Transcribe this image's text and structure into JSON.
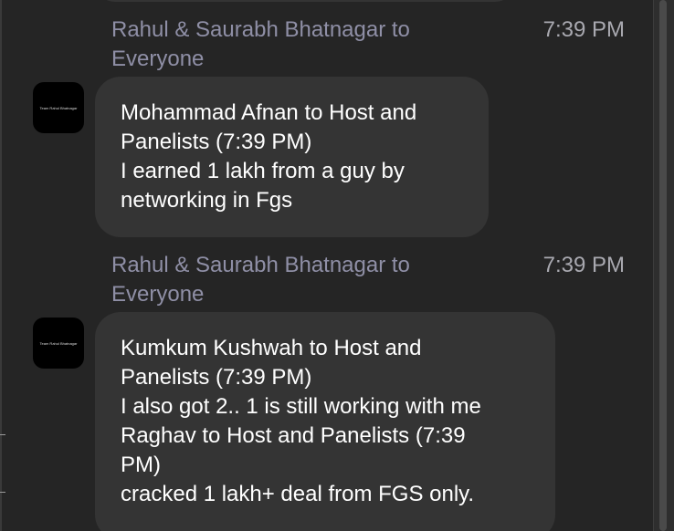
{
  "messages": [
    {
      "sender_line1": "Rahul & Saurabh Bhatnagar to",
      "sender_line2": "Everyone",
      "time": "7:39 PM",
      "avatar_text": "Team Rahul Bhatnagar",
      "body": [
        "Mohammad Afnan to Host and",
        "Panelists (7:39 PM)",
        "I earned 1 lakh from a guy by",
        "networking in Fgs"
      ]
    },
    {
      "sender_line1": "Rahul & Saurabh Bhatnagar to",
      "sender_line2": "Everyone",
      "time": "7:39 PM",
      "avatar_text": "Team Rahul Bhatnagar",
      "body": [
        "Kumkum Kushwah to Host and",
        "Panelists (7:39 PM)",
        "I also got 2.. 1 is still working with me",
        "Raghav to Host and Panelists (7:39",
        "PM)",
        "cracked 1 lakh+ deal from FGS only."
      ]
    }
  ]
}
